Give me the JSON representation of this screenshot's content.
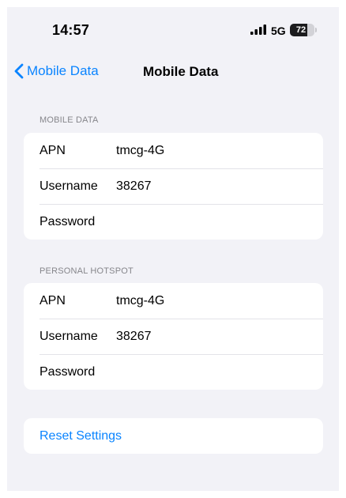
{
  "status_bar": {
    "time": "14:57",
    "network": "5G",
    "battery_level": "72",
    "battery_fraction": 0.72
  },
  "nav": {
    "back_label": "Mobile Data",
    "title": "Mobile Data"
  },
  "mobile_data": {
    "header": "MOBILE DATA",
    "rows": [
      {
        "label": "APN",
        "value": "tmcg-4G"
      },
      {
        "label": "Username",
        "value": "38267"
      },
      {
        "label": "Password",
        "value": ""
      }
    ]
  },
  "personal_hotspot": {
    "header": "PERSONAL HOTSPOT",
    "rows": [
      {
        "label": "APN",
        "value": "tmcg-4G"
      },
      {
        "label": "Username",
        "value": "38267"
      },
      {
        "label": "Password",
        "value": ""
      }
    ]
  },
  "reset": {
    "label": "Reset Settings"
  },
  "colors": {
    "accent": "#0a84ff",
    "background": "#f2f2f7",
    "cell": "#ffffff",
    "header_text": "#86868b"
  },
  "icons": {
    "back": "chevron-left-icon",
    "signal": "cellular-signal-icon",
    "battery": "battery-icon"
  }
}
